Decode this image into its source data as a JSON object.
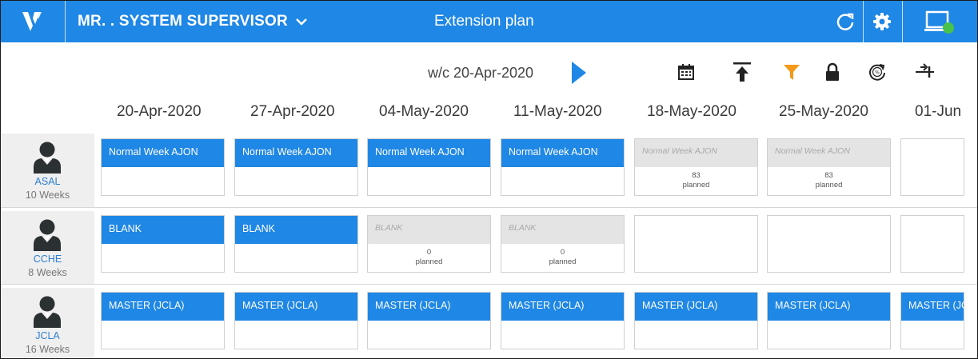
{
  "header": {
    "user_label": "MR. . SYSTEM SUPERVISOR",
    "app_title": "Extension plan",
    "status_color": "#49c24a",
    "accent_color": "#1f87e5"
  },
  "toolbar": {
    "week_commencing": "w/c 20-Apr-2020",
    "icons": [
      "calendar-icon",
      "scroll-top-icon",
      "filter-icon",
      "lock-icon",
      "percent-refresh-icon",
      "expand-columns-icon"
    ]
  },
  "dates": [
    "20-Apr-2020",
    "27-Apr-2020",
    "04-May-2020",
    "11-May-2020",
    "18-May-2020",
    "25-May-2020",
    "01-Jun"
  ],
  "rows": [
    {
      "code": "ASAL",
      "weeks": "10 Weeks",
      "cells": [
        {
          "title": "Normal Week AJON"
        },
        {
          "title": "Normal Week AJON"
        },
        {
          "title": "Normal Week AJON"
        },
        {
          "title": "Normal Week AJON"
        },
        {
          "title": "Normal Week AJON",
          "count": "83",
          "status": "planned"
        },
        {
          "title": "Normal Week AJON",
          "count": "83",
          "status": "planned"
        },
        {
          "title": ""
        }
      ]
    },
    {
      "code": "CCHE",
      "weeks": "8  Weeks",
      "cells": [
        {
          "title": "BLANK"
        },
        {
          "title": "BLANK"
        },
        {
          "title": "BLANK",
          "count": "0",
          "status": "planned"
        },
        {
          "title": "BLANK",
          "count": "0",
          "status": "planned"
        },
        {
          "title": ""
        },
        {
          "title": ""
        },
        {
          "title": ""
        }
      ]
    },
    {
      "code": "JCLA",
      "weeks": "16  Weeks",
      "cells": [
        {
          "title": "MASTER (JCLA)"
        },
        {
          "title": "MASTER (JCLA)"
        },
        {
          "title": "MASTER (JCLA)"
        },
        {
          "title": "MASTER (JCLA)"
        },
        {
          "title": "MASTER (JCLA)"
        },
        {
          "title": "MASTER (JCLA)"
        },
        {
          "title": "MASTER (JC"
        }
      ]
    }
  ]
}
